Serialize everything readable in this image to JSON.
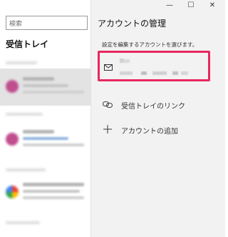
{
  "left_pane": {
    "search_placeholder": "検索",
    "folder_title": "受信トレイ"
  },
  "window_controls": {
    "minimize": "—",
    "maximize": "☐",
    "close": "✕"
  },
  "account_panel": {
    "title": "アカウントの管理",
    "subtitle": "設定を編集するアカウントを選びます。",
    "actions": [
      {
        "label": "受信トレイのリンク",
        "icon": "link-icon"
      },
      {
        "label": "アカウントの追加",
        "icon": "plus-icon"
      }
    ]
  },
  "colors": {
    "highlight": "#e8275f",
    "panel_bg": "#f2f2f2",
    "selected_item_bg": "#e3e3e3"
  }
}
